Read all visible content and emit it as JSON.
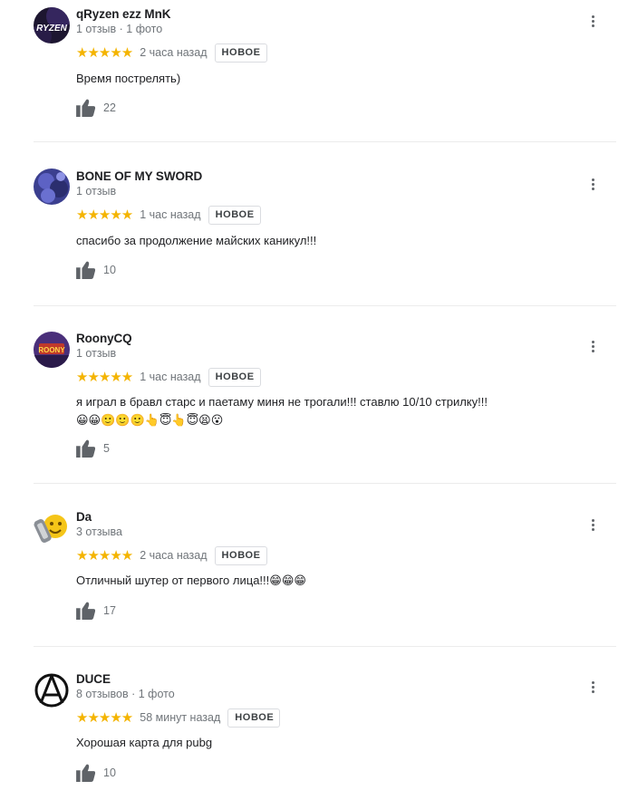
{
  "reviews": [
    {
      "author": "qRyzen ezz MnK",
      "meta": "1 отзыв · 1 фото",
      "stars": "★★★★★",
      "time": "2 часа назад",
      "badge": "НОВОЕ",
      "text": "Время пострелять)",
      "likes": "22",
      "avatar_text": "RYZEN"
    },
    {
      "author": "BONE OF MY SWORD",
      "meta": "1 отзыв",
      "stars": "★★★★★",
      "time": "1 час назад",
      "badge": "НОВОЕ",
      "text": "спасибо за продолжение майских каникул!!!",
      "likes": "10"
    },
    {
      "author": "RoonyCQ",
      "meta": "1 отзыв",
      "stars": "★★★★★",
      "time": "1 час назад",
      "badge": "НОВОЕ",
      "text": "я играл в бравл старс и паетаму миня не трогали!!! ставлю 10/10 стрилку!!!",
      "emoji": "😀😀🙂🙂🙂👆😇👆😇😫😮",
      "likes": "5",
      "avatar_text": "ROONY"
    },
    {
      "author": "Da",
      "meta": "3 отзыва",
      "stars": "★★★★★",
      "time": "2 часа назад",
      "badge": "НОВОЕ",
      "text": "Отличный шутер от первого лица!!!",
      "emoji": "😁😁😁",
      "likes": "17"
    },
    {
      "author": "DUCE",
      "meta": "8 отзывов · 1 фото",
      "stars": "★★★★★",
      "time": "58 минут назад",
      "badge": "НОВОЕ",
      "text": "Хорошая карта для pubg",
      "likes": "10"
    }
  ],
  "colors": {
    "star": "#f4b400",
    "meta_text": "#70757a",
    "badge_border": "#dadce0",
    "icon": "#5f6368"
  },
  "icons": {
    "like": "thumb-up-icon",
    "menu": "more-vert-icon"
  }
}
